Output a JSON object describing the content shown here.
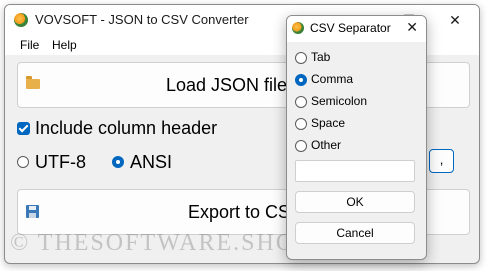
{
  "window": {
    "title": "VOVSOFT - JSON to CSV Converter",
    "minimize_glyph": "—",
    "maximize_glyph": "☐",
    "close_glyph": "✕"
  },
  "menu": {
    "items": [
      "File",
      "Help"
    ]
  },
  "main": {
    "load_button_label": "Load JSON file",
    "include_header_label": "Include column header",
    "include_header_checked": true,
    "encoding": {
      "options": [
        "UTF-8",
        "ANSI"
      ],
      "selected": "ANSI"
    },
    "separator_button_label": ",",
    "export_button_label": "Export to CSV"
  },
  "watermark": "© THESOFTWARE.SHOP",
  "dialog": {
    "title": "CSV Separator",
    "close_glyph": "✕",
    "options": [
      "Tab",
      "Comma",
      "Semicolon",
      "Space",
      "Other"
    ],
    "selected": "Comma",
    "other_value": "",
    "ok_label": "OK",
    "cancel_label": "Cancel"
  },
  "colors": {
    "accent": "#0067c0",
    "window_bg": "#f0f0f0"
  },
  "icons": {
    "app": "vovsoft-app-icon",
    "load": "folder-icon",
    "export": "save-icon"
  }
}
